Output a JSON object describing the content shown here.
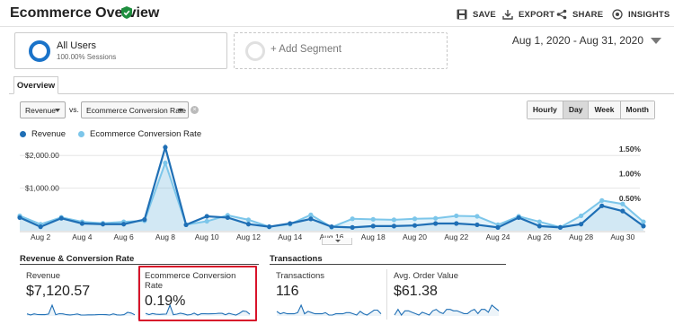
{
  "header": {
    "title": "Ecommerce Overview",
    "buttons": {
      "save": "SAVE",
      "export": "EXPORT",
      "share": "SHARE",
      "insights": "INSIGHTS"
    }
  },
  "segments": {
    "active": {
      "name": "All Users",
      "sub": "100.00% Sessions"
    },
    "add_label": "+ Add Segment"
  },
  "date_range": "Aug 1, 2020 - Aug 31, 2020",
  "tabs": [
    "Overview"
  ],
  "controls": {
    "metric1": "Revenue",
    "vs": "vs.",
    "metric2": "Ecommerce Conversion Rate",
    "remove": "×",
    "granularity": [
      "Hourly",
      "Day",
      "Week",
      "Month"
    ],
    "granularity_active": "Day"
  },
  "colors": {
    "revenue": "#1f6fb5",
    "conversion": "#7cc6ea",
    "highlight": "#d8132b"
  },
  "chart_data": {
    "type": "line",
    "x": [
      "Aug 1",
      "Aug 2",
      "Aug 3",
      "Aug 4",
      "Aug 5",
      "Aug 6",
      "Aug 7",
      "Aug 8",
      "Aug 9",
      "Aug 10",
      "Aug 11",
      "Aug 12",
      "Aug 13",
      "Aug 14",
      "Aug 15",
      "Aug 16",
      "Aug 17",
      "Aug 18",
      "Aug 19",
      "Aug 20",
      "Aug 21",
      "Aug 22",
      "Aug 23",
      "Aug 24",
      "Aug 25",
      "Aug 26",
      "Aug 27",
      "Aug 28",
      "Aug 29",
      "Aug 30",
      "Aug 31"
    ],
    "x_tick_labels": [
      "Aug 2",
      "Aug 4",
      "Aug 6",
      "Aug 8",
      "Aug 10",
      "Aug 12",
      "Aug 14",
      "Aug 16",
      "Aug 18",
      "Aug 20",
      "Aug 22",
      "Aug 24",
      "Aug 26",
      "Aug 28",
      "Aug 30"
    ],
    "series": [
      {
        "name": "Revenue",
        "axis": "left",
        "values": [
          100,
          -180,
          80,
          -80,
          -100,
          -100,
          40,
          2250,
          -120,
          140,
          100,
          -100,
          -180,
          -80,
          60,
          -180,
          -200,
          -160,
          -160,
          -140,
          -80,
          -80,
          -120,
          -200,
          100,
          -160,
          -200,
          -100,
          460,
          300,
          -160
        ]
      },
      {
        "name": "Ecommerce Conversion Rate",
        "axis": "right",
        "values": [
          0.15,
          -0.02,
          0.12,
          0.03,
          0.0,
          0.03,
          0.05,
          1.22,
          -0.03,
          0.04,
          0.16,
          0.07,
          -0.07,
          -0.02,
          0.17,
          -0.08,
          0.09,
          0.08,
          0.07,
          0.09,
          0.1,
          0.15,
          0.14,
          -0.03,
          0.14,
          0.03,
          -0.08,
          0.15,
          0.46,
          0.39,
          0.03
        ]
      }
    ],
    "left_axis": {
      "ticks": [
        "$2,000.00",
        "$1,000.00"
      ],
      "range": [
        -300,
        2500
      ]
    },
    "right_axis": {
      "ticks": [
        "1.50%",
        "1.00%",
        "0.50%"
      ],
      "range": [
        -0.15,
        1.7
      ]
    },
    "grid": true,
    "legend": "top-left"
  },
  "scorecards": {
    "section1_title": "Revenue & Conversion Rate",
    "section2_title": "Transactions",
    "cards": [
      {
        "label": "Revenue",
        "value": "$7,120.57"
      },
      {
        "label": "Ecommerce Conversion Rate",
        "value": "0.19%"
      },
      {
        "label": "Transactions",
        "value": "116"
      },
      {
        "label": "Avg. Order Value",
        "value": "$61.38"
      }
    ]
  }
}
